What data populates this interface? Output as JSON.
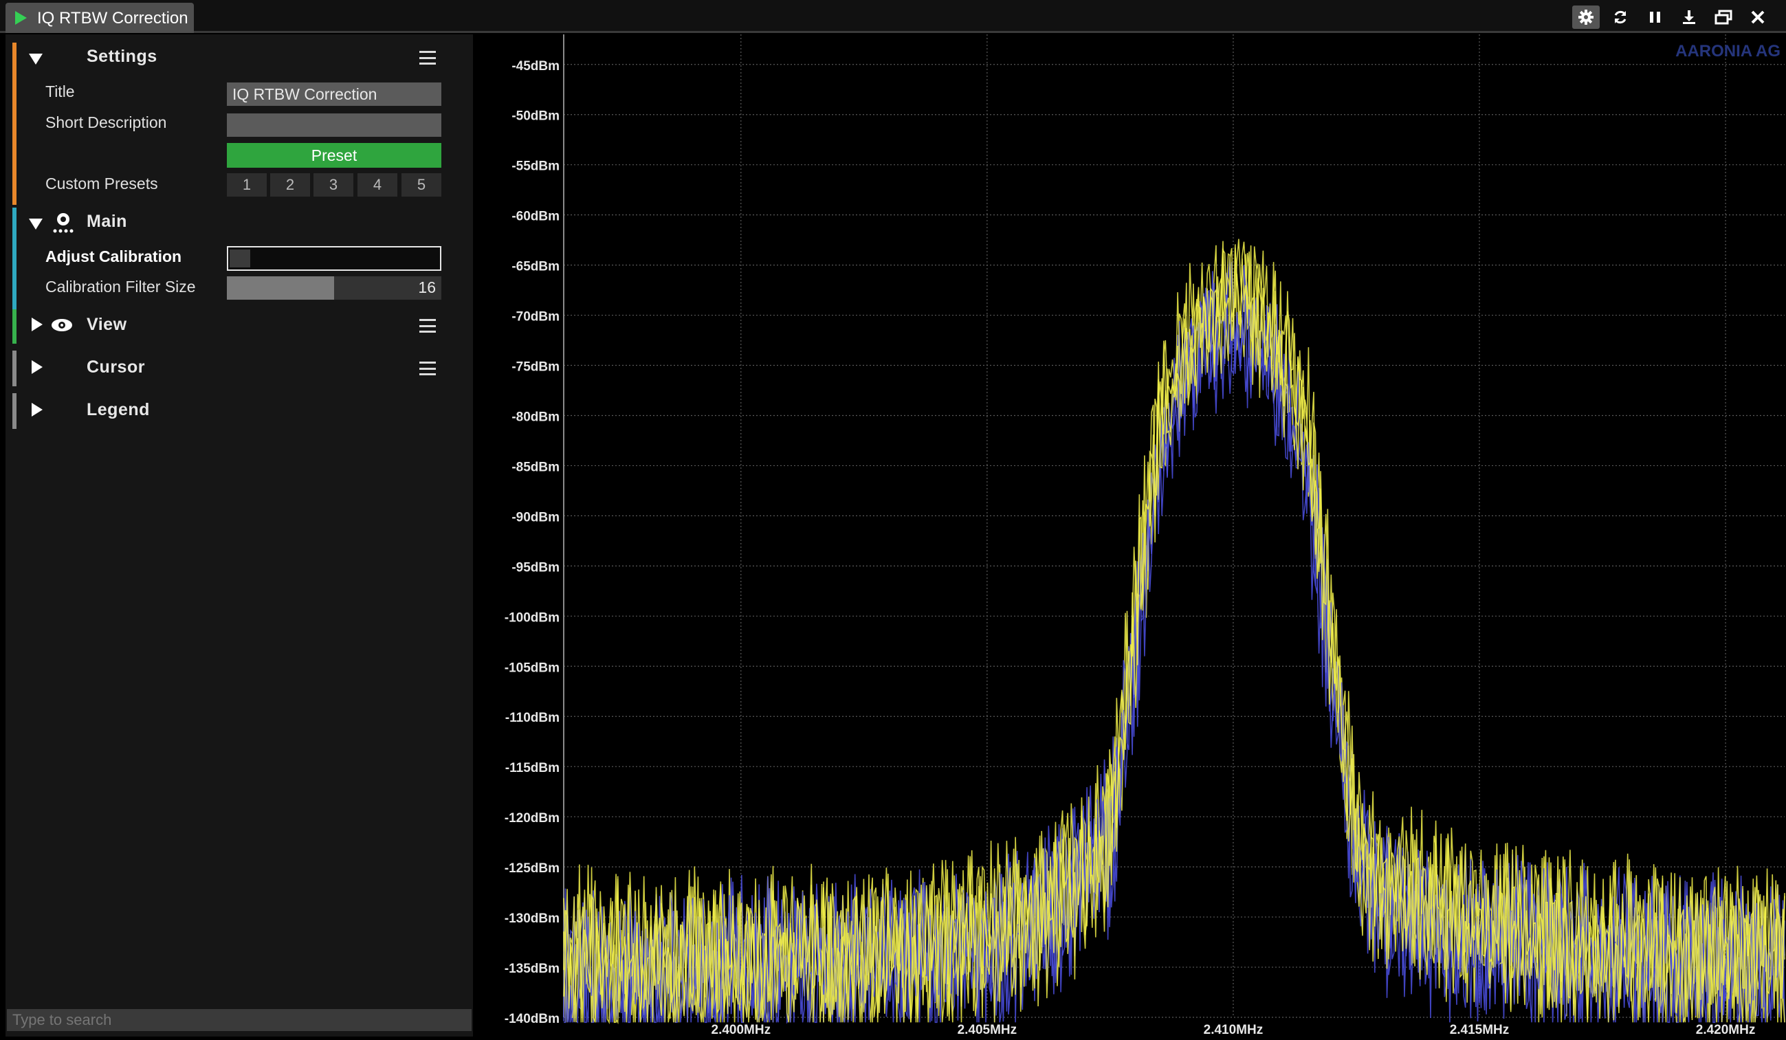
{
  "window": {
    "tab_title": "IQ RTBW Correction"
  },
  "toolbar": {
    "buttons": [
      "settings",
      "refresh",
      "pause",
      "download",
      "window",
      "close"
    ]
  },
  "sidebar": {
    "settings": {
      "label": "Settings",
      "title_label": "Title",
      "title_value": "IQ RTBW Correction",
      "short_description_label": "Short Description",
      "short_description_value": "",
      "preset_label": "Preset",
      "custom_presets_label": "Custom Presets",
      "custom_presets": [
        "1",
        "2",
        "3",
        "4",
        "5"
      ]
    },
    "main": {
      "label": "Main",
      "adjust_calibration_label": "Adjust Calibration",
      "calibration_filter_size_label": "Calibration Filter Size",
      "calibration_filter_size_value": "16",
      "calibration_filter_size_fraction": 0.5
    },
    "view": {
      "label": "View"
    },
    "cursor": {
      "label": "Cursor"
    },
    "legend": {
      "label": "Legend"
    },
    "search_placeholder": "Type to search"
  },
  "colors": {
    "settings_bar": "#e8872a",
    "main_bar": "#2fa9c0",
    "view_bar": "#37b24d",
    "cursor_bar": "#8a8a8a",
    "legend_bar": "#8a8a8a",
    "series_yellow": "#f2f04a",
    "series_blue": "#4b4fe0"
  },
  "chart_data": {
    "type": "line",
    "xlabel": "",
    "ylabel": "",
    "x_unit": "MHz",
    "y_unit": "dBm",
    "xlim": [
      2.3964,
      2.4212
    ],
    "ylim": [
      -140,
      -42
    ],
    "yticks": [
      "-45dBm",
      "-50dBm",
      "-55dBm",
      "-60dBm",
      "-65dBm",
      "-70dBm",
      "-75dBm",
      "-80dBm",
      "-85dBm",
      "-90dBm",
      "-95dBm",
      "-100dBm",
      "-105dBm",
      "-110dBm",
      "-115dBm",
      "-120dBm",
      "-125dBm",
      "-130dBm",
      "-135dBm",
      "-140dBm"
    ],
    "ytick_values": [
      -45,
      -50,
      -55,
      -60,
      -65,
      -70,
      -75,
      -80,
      -85,
      -90,
      -95,
      -100,
      -105,
      -110,
      -115,
      -120,
      -125,
      -130,
      -135,
      -140
    ],
    "xticks": [
      "2.400MHz",
      "2.405MHz",
      "2.410MHz",
      "2.415MHz",
      "2.420MHz"
    ],
    "xtick_values": [
      2.4,
      2.405,
      2.41,
      2.415,
      2.42
    ],
    "grid": true,
    "watermark": "AARONIA AG",
    "series": [
      {
        "color": "#f2f04a",
        "x": [
          2.3964,
          2.398,
          2.4,
          2.402,
          2.404,
          2.405,
          2.406,
          2.4065,
          2.407,
          2.4075,
          2.408,
          2.4085,
          2.409,
          2.4095,
          2.41,
          2.4105,
          2.411,
          2.4115,
          2.412,
          2.4125,
          2.413,
          2.414,
          2.415,
          2.416,
          2.418,
          2.42,
          2.4212
        ],
        "y": [
          -133,
          -134,
          -133,
          -133,
          -132,
          -131,
          -129,
          -127,
          -125,
          -121,
          -100,
          -80,
          -72,
          -69,
          -66,
          -69,
          -73,
          -80,
          -101,
          -122,
          -126,
          -128,
          -130,
          -131,
          -132,
          -133,
          -133
        ]
      },
      {
        "color": "#4b4fe0",
        "x": [
          2.3964,
          2.398,
          2.4,
          2.402,
          2.404,
          2.405,
          2.406,
          2.4065,
          2.407,
          2.4075,
          2.408,
          2.4085,
          2.409,
          2.4095,
          2.41,
          2.4105,
          2.411,
          2.4115,
          2.412,
          2.4125,
          2.413,
          2.414,
          2.415,
          2.416,
          2.418,
          2.42,
          2.4212
        ],
        "y": [
          -135,
          -135,
          -134,
          -134,
          -133,
          -132,
          -130,
          -128,
          -124,
          -122,
          -104,
          -83,
          -75,
          -72,
          -70,
          -72,
          -76,
          -84,
          -105,
          -124,
          -128,
          -130,
          -131,
          -132,
          -133,
          -134,
          -134
        ]
      }
    ]
  }
}
